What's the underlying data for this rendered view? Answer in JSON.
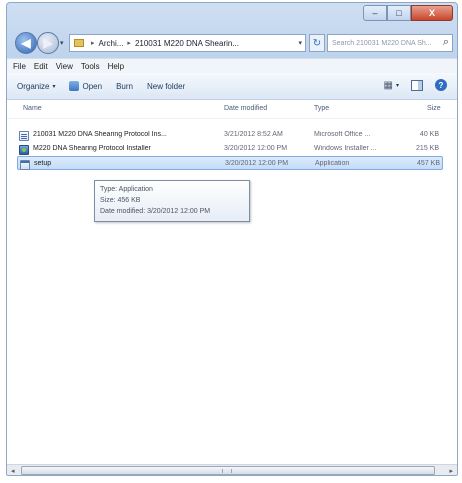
{
  "window": {
    "controls": {
      "minimize": "–",
      "maximize": "□",
      "close": "X"
    }
  },
  "address_bar": {
    "back_glyph": "◀",
    "forward_glyph": "▶",
    "recent_glyph": "▾",
    "path": [
      "Archi...",
      "210031 M220 DNA Shearin..."
    ],
    "separator": "▸",
    "dropdown_glyph": "▾",
    "refresh_glyph": "↻",
    "search_placeholder": "Search 210031 M220 DNA Sh...",
    "search_icon": "⌕"
  },
  "menu": [
    "File",
    "Edit",
    "View",
    "Tools",
    "Help"
  ],
  "toolbar": {
    "organize": "Organize",
    "open": "Open",
    "burn": "Burn",
    "new_folder": "New folder",
    "views_glyph": "▦",
    "views_chevron": "▾",
    "help_glyph": "?",
    "chevron": "▾"
  },
  "columns": {
    "name": "Name",
    "date": "Date modified",
    "type": "Type",
    "size": "Size"
  },
  "files": [
    {
      "name": "210031 M220 DNA Shearing Protocol Ins...",
      "date": "3/21/2012 8:52 AM",
      "type": "Microsoft Office ...",
      "size": "40 KB",
      "icon": "word-doc-icon"
    },
    {
      "name": "M220 DNA Shearing Protocol Installer",
      "date": "3/20/2012 12:00 PM",
      "type": "Windows Installer ...",
      "size": "215 KB",
      "icon": "installer-icon"
    },
    {
      "name": "setup",
      "date": "3/20/2012 12:00 PM",
      "type": "Application",
      "size": "457 KB",
      "icon": "application-icon"
    }
  ],
  "tooltip": {
    "line1": "Type: Application",
    "line2": "Size: 456 KB",
    "line3": "Date modified: 3/20/2012 12:00 PM"
  },
  "scrollbar": {
    "left": "◂",
    "right": "▸"
  }
}
